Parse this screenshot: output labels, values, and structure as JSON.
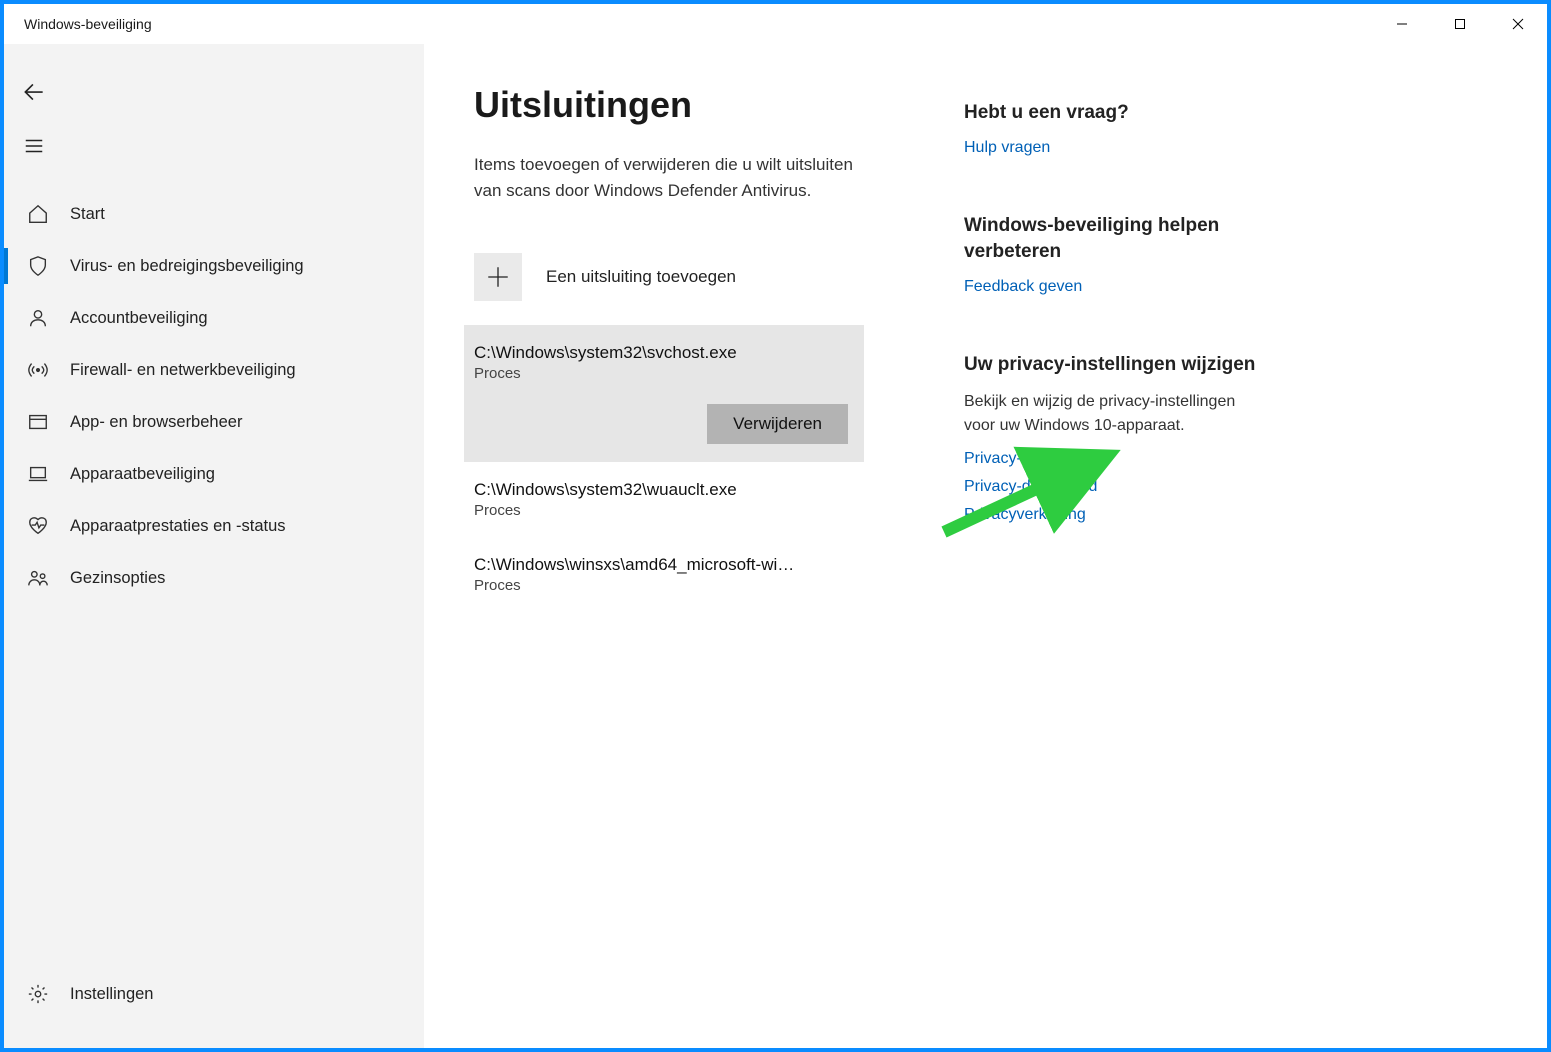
{
  "window": {
    "title": "Windows-beveiliging"
  },
  "sidebar": {
    "items": [
      {
        "id": "home",
        "label": "Start"
      },
      {
        "id": "virus",
        "label": "Virus- en bedreigingsbeveiliging",
        "selected": true
      },
      {
        "id": "account",
        "label": "Accountbeveiliging"
      },
      {
        "id": "firewall",
        "label": "Firewall- en netwerkbeveiliging"
      },
      {
        "id": "appbrowser",
        "label": "App- en browserbeheer"
      },
      {
        "id": "device",
        "label": "Apparaatbeveiliging"
      },
      {
        "id": "perf",
        "label": "Apparaatprestaties en -status"
      },
      {
        "id": "family",
        "label": "Gezinsopties"
      }
    ],
    "settings_label": "Instellingen"
  },
  "main": {
    "title": "Uitsluitingen",
    "description": "Items toevoegen of verwijderen die u wilt uitsluiten van scans door Windows Defender Antivirus.",
    "add_label": "Een uitsluiting toevoegen",
    "remove_label": "Verwijderen",
    "type_label": "Proces",
    "exclusions": [
      {
        "path": "C:\\Windows\\system32\\svchost.exe",
        "type": "Proces",
        "expanded": true
      },
      {
        "path": "C:\\Windows\\system32\\wuauclt.exe",
        "type": "Proces"
      },
      {
        "path": "C:\\Windows\\winsxs\\amd64_microsoft-wi…",
        "type": "Proces"
      }
    ]
  },
  "aside": {
    "help": {
      "title": "Hebt u een vraag?",
      "link": "Hulp vragen"
    },
    "improve": {
      "title": "Windows-beveiliging helpen verbeteren",
      "link": "Feedback geven"
    },
    "privacy": {
      "title": "Uw privacy-instellingen wijzigen",
      "text": "Bekijk en wijzig de privacy-instellingen voor uw Windows 10-apparaat.",
      "links": [
        "Privacy-instellingen",
        "Privacy-dashboard",
        "Privacyverklaring"
      ]
    }
  },
  "colors": {
    "accent": "#0078d4",
    "link": "#0060b6",
    "arrow": "#2ecc40"
  }
}
